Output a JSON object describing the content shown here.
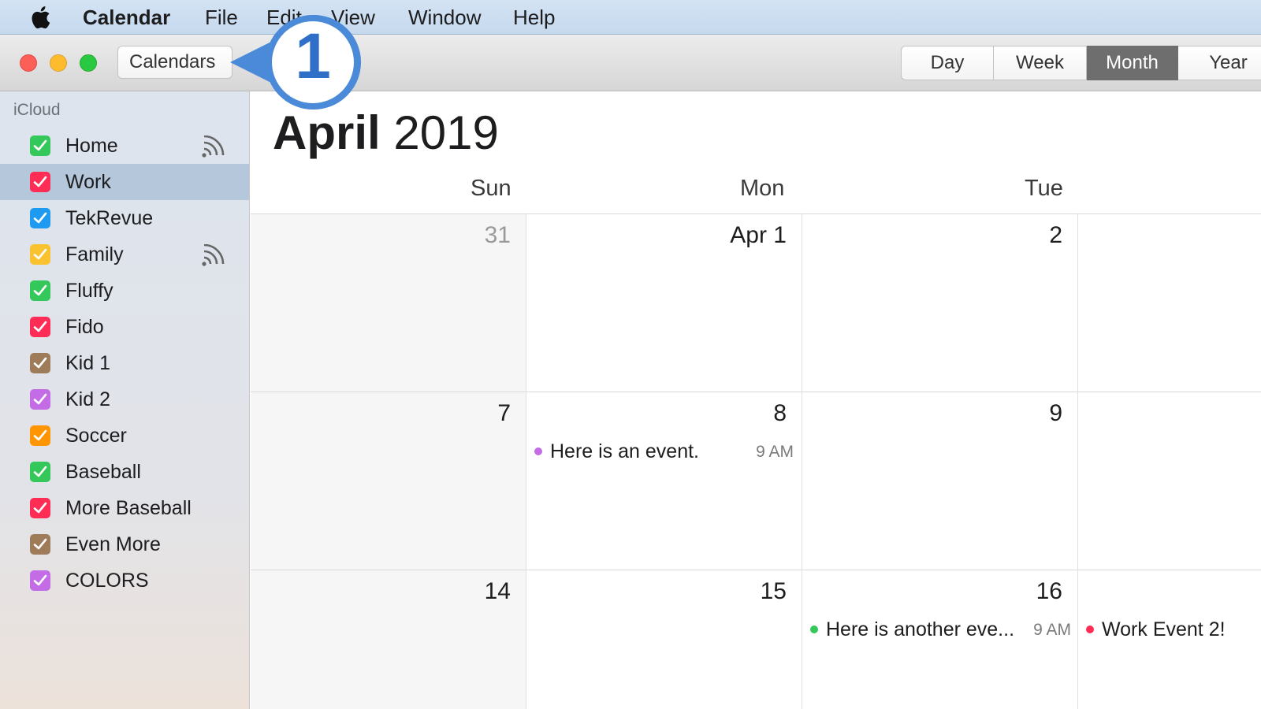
{
  "menubar": {
    "app": "Calendar",
    "items": [
      "File",
      "Edit",
      "View",
      "Window",
      "Help"
    ]
  },
  "toolbar": {
    "calendars_label": "Calendars",
    "callout_number": "1",
    "views": [
      {
        "label": "Day",
        "active": false
      },
      {
        "label": "Week",
        "active": false
      },
      {
        "label": "Month",
        "active": true
      },
      {
        "label": "Year",
        "active": false
      }
    ]
  },
  "sidebar": {
    "group": "iCloud",
    "calendars": [
      {
        "label": "Home",
        "color": "#34c759",
        "shared": true,
        "selected": false
      },
      {
        "label": "Work",
        "color": "#ff2d55",
        "shared": false,
        "selected": true
      },
      {
        "label": "TekRevue",
        "color": "#1e9bf0",
        "shared": false,
        "selected": false
      },
      {
        "label": "Family",
        "color": "#f9c22e",
        "shared": true,
        "selected": false
      },
      {
        "label": "Fluffy",
        "color": "#34c759",
        "shared": false,
        "selected": false
      },
      {
        "label": "Fido",
        "color": "#ff2d55",
        "shared": false,
        "selected": false
      },
      {
        "label": "Kid 1",
        "color": "#9e7c5a",
        "shared": false,
        "selected": false
      },
      {
        "label": "Kid 2",
        "color": "#c36ce6",
        "shared": false,
        "selected": false
      },
      {
        "label": "Soccer",
        "color": "#ff9500",
        "shared": false,
        "selected": false
      },
      {
        "label": "Baseball",
        "color": "#34c759",
        "shared": false,
        "selected": false
      },
      {
        "label": "More Baseball",
        "color": "#ff2d55",
        "shared": false,
        "selected": false
      },
      {
        "label": "Even More",
        "color": "#9e7c5a",
        "shared": false,
        "selected": false
      },
      {
        "label": "COLORS",
        "color": "#c36ce6",
        "shared": false,
        "selected": false
      }
    ]
  },
  "main": {
    "month": "April",
    "year": "2019",
    "weekdays": [
      "Sun",
      "Mon",
      "Tue"
    ],
    "weeks": [
      [
        "31",
        "Apr 1",
        "2",
        ""
      ],
      [
        "7",
        "8",
        "9",
        ""
      ],
      [
        "14",
        "15",
        "16",
        ""
      ]
    ],
    "events": [
      {
        "week": 1,
        "day": 1,
        "title": "Here is an event.",
        "time": "9 AM",
        "color": "#c36ce6"
      },
      {
        "week": 2,
        "day": 2,
        "title": "Here is another eve...",
        "time": "9 AM",
        "color": "#34c759"
      },
      {
        "week": 2,
        "day": 3,
        "title": "Work Event 2!",
        "time": "",
        "color": "#ff2d55"
      }
    ]
  }
}
